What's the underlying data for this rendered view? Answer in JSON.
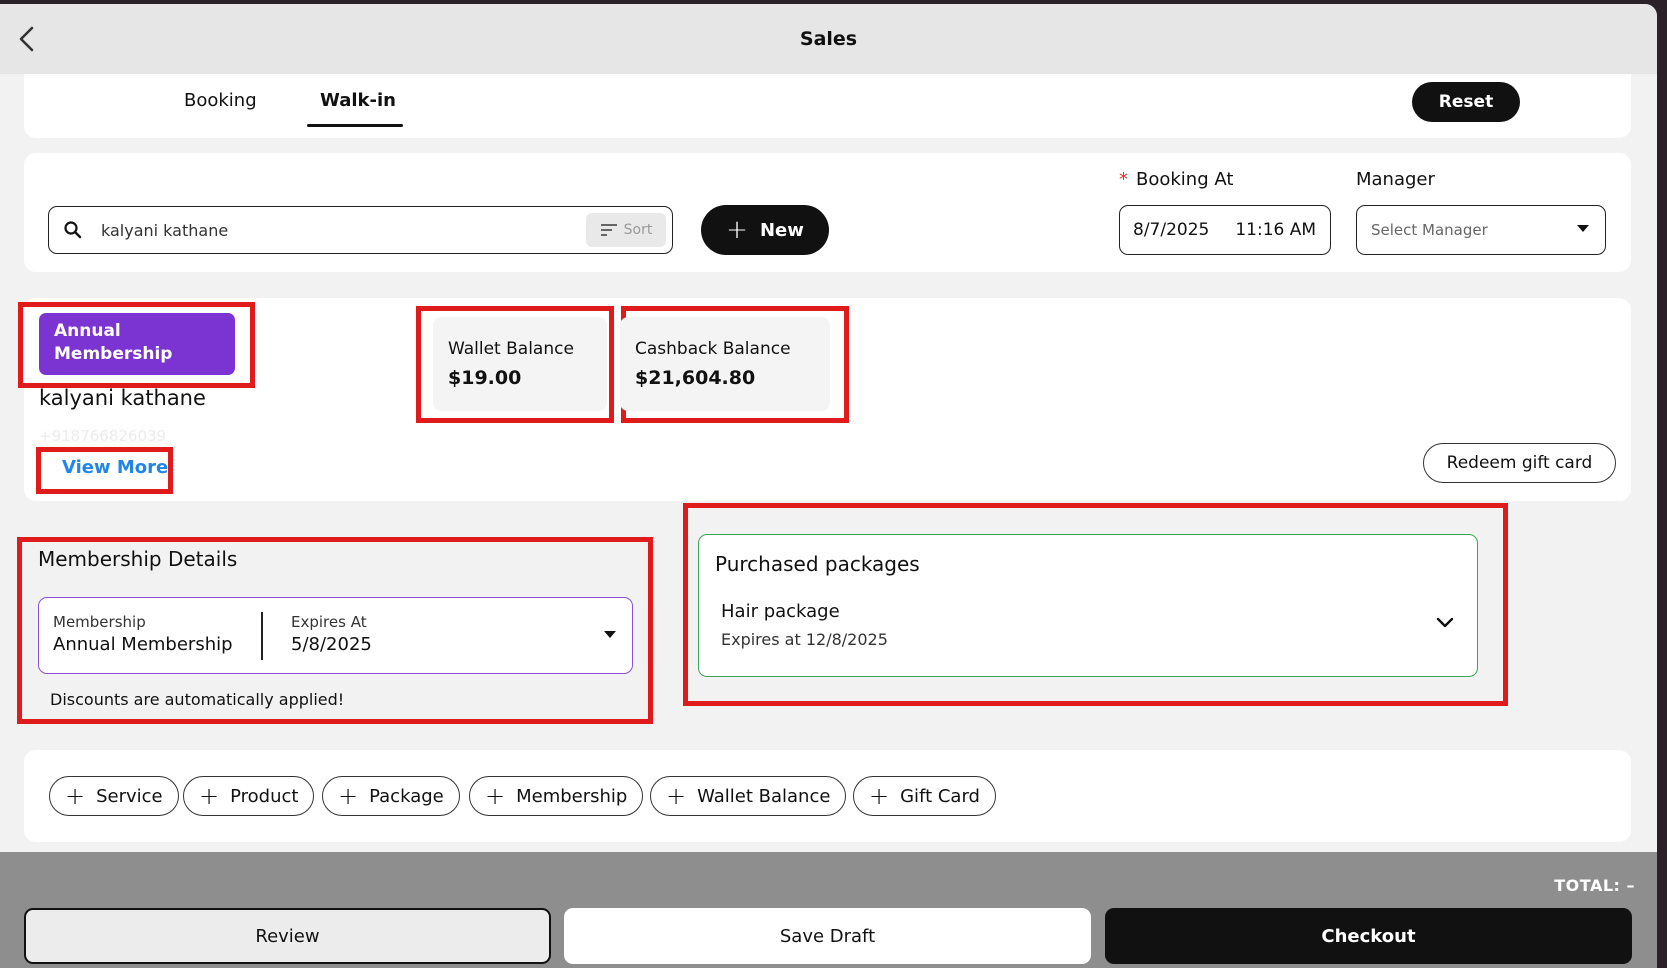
{
  "header": {
    "title": "Sales"
  },
  "tabs": [
    {
      "label": "Booking"
    },
    {
      "label": "Walk-in"
    }
  ],
  "reset_label": "Reset",
  "search": {
    "value": "kalyani kathane",
    "sort_label": "Sort"
  },
  "new_label": "New",
  "booking_at": {
    "label": "Booking At",
    "required_mark": "*",
    "date": "8/7/2025",
    "time": "11:16 AM"
  },
  "manager": {
    "label": "Manager",
    "placeholder": "Select Manager"
  },
  "customer": {
    "badge": "Annual Membership",
    "name": "kalyani kathane",
    "phone": "+918766826039",
    "view_more": "View More"
  },
  "wallet": {
    "label": "Wallet Balance",
    "value": "$19.00"
  },
  "cashback": {
    "label": "Cashback Balance",
    "value": "$21,604.80"
  },
  "redeem_label": "Redeem gift card",
  "membership_details": {
    "title": "Membership Details",
    "membership_label": "Membership",
    "membership_value": "Annual Membership",
    "expires_label": "Expires At",
    "expires_value": "5/8/2025",
    "note": "Discounts are automatically applied!"
  },
  "packages": {
    "title": "Purchased packages",
    "items": [
      {
        "name": "Hair package",
        "expires": "Expires at 12/8/2025"
      }
    ]
  },
  "add_items": [
    {
      "label": "Service"
    },
    {
      "label": "Product"
    },
    {
      "label": "Package"
    },
    {
      "label": "Membership"
    },
    {
      "label": "Wallet Balance"
    },
    {
      "label": "Gift Card"
    }
  ],
  "footer": {
    "total": "TOTAL:  –",
    "review": "Review",
    "save_draft": "Save Draft",
    "checkout": "Checkout"
  },
  "colors": {
    "accent_purple": "#7b34d1",
    "link_blue": "#2186e8",
    "highlight_red": "#e01b1b",
    "package_green": "#3aa65a"
  }
}
